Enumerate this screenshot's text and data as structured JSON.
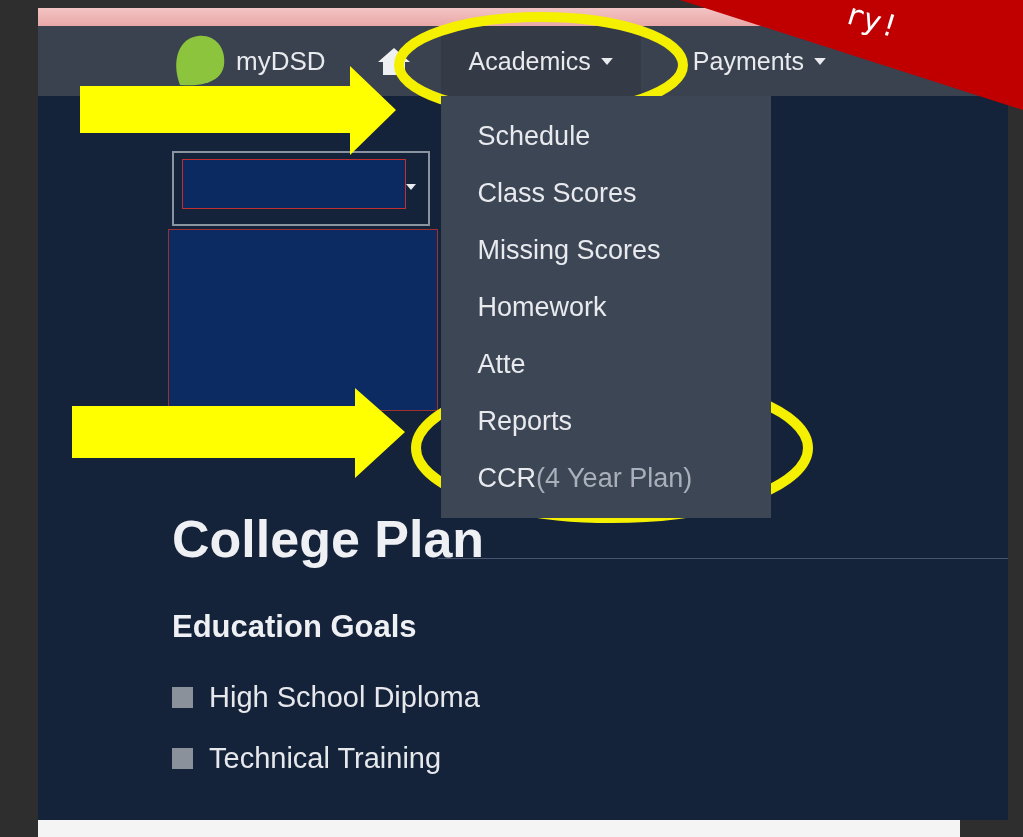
{
  "banner": {
    "text": "ry!"
  },
  "nav": {
    "logo": "myDSD",
    "menus": [
      {
        "label": "Academics",
        "expanded": true
      },
      {
        "label": "Payments",
        "expanded": false
      }
    ]
  },
  "dropdown": {
    "items": [
      {
        "label": "Schedule"
      },
      {
        "label": "Class Scores"
      },
      {
        "label": "Missing Scores"
      },
      {
        "label": "Homework"
      },
      {
        "label": "Atte"
      },
      {
        "label": "Reports"
      },
      {
        "label": "CCR",
        "note": "(4 Year Plan)"
      }
    ]
  },
  "page": {
    "title": "College Plan",
    "section": "Education Goals",
    "goals": [
      {
        "label": "High School Diploma",
        "checked": false
      },
      {
        "label": "Technical Training",
        "checked": false
      }
    ]
  }
}
